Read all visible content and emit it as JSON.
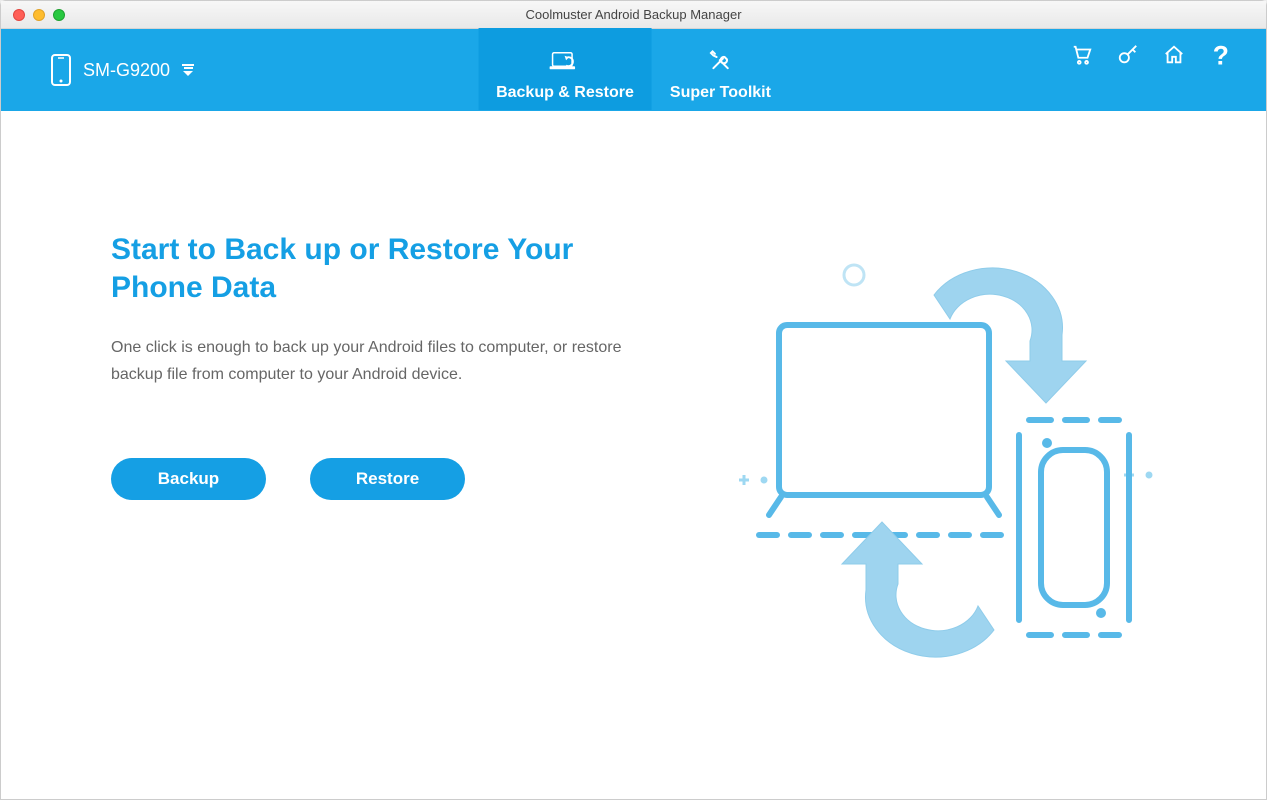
{
  "window": {
    "title": "Coolmuster Android Backup Manager"
  },
  "header": {
    "device_name": "SM-G9200",
    "tabs": [
      {
        "label": "Backup & Restore",
        "active": true
      },
      {
        "label": "Super Toolkit",
        "active": false
      }
    ]
  },
  "main": {
    "heading": "Start to Back up or Restore Your Phone Data",
    "description": "One click is enough to back up your Android files to computer, or restore backup file from computer to your Android device.",
    "backup_label": "Backup",
    "restore_label": "Restore"
  },
  "colors": {
    "primary": "#1aa7e8",
    "accent": "#159fe4"
  }
}
